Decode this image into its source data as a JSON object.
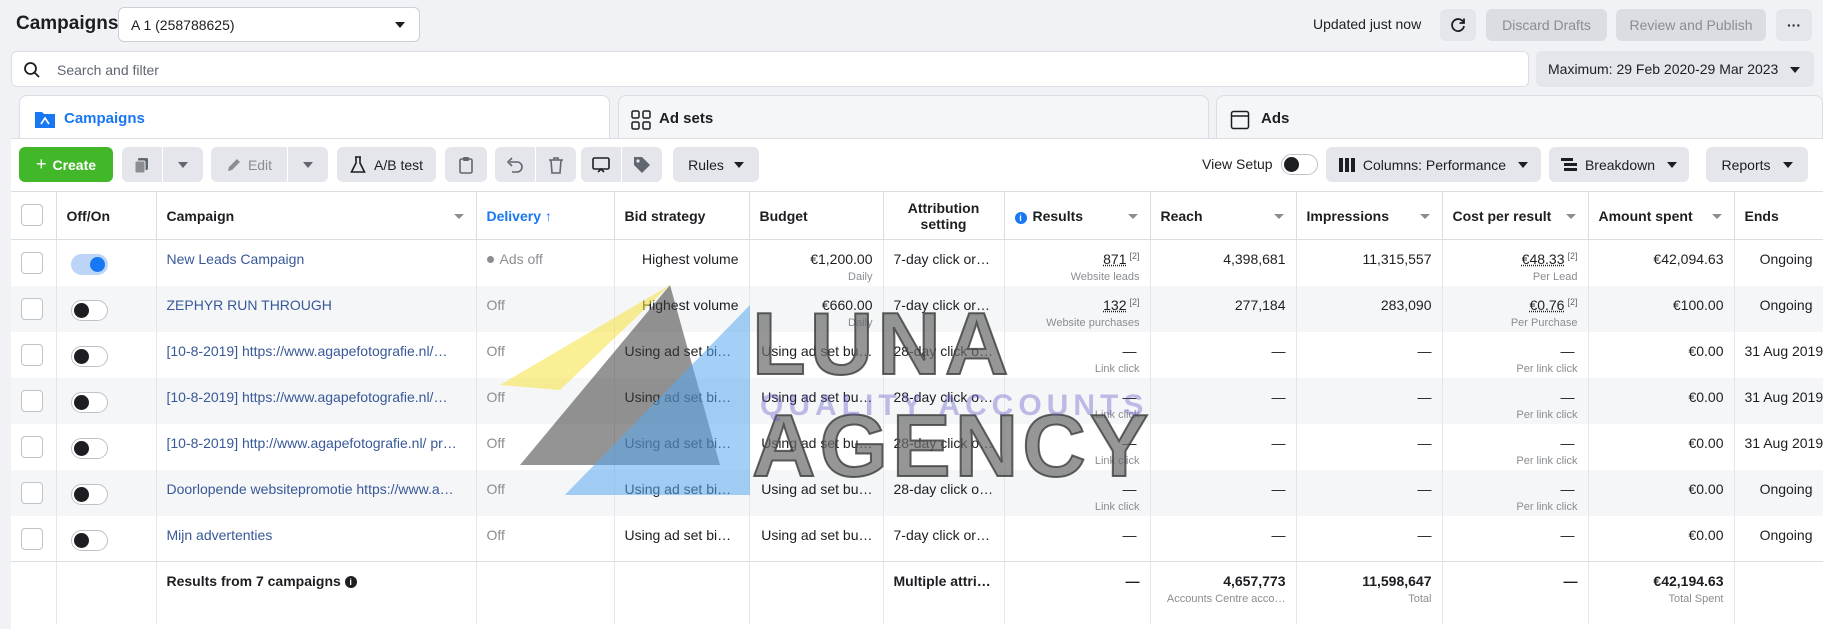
{
  "header": {
    "title": "Campaigns",
    "account_select": "A 1 (258788625)",
    "updated_text": "Updated just now",
    "discard_label": "Discard Drafts",
    "review_label": "Review and Publish",
    "more_label": "···"
  },
  "search": {
    "placeholder": "Search and filter"
  },
  "date_range": "Maximum: 29 Feb 2020-29 Mar 2023",
  "tabs": [
    {
      "label": "Campaigns",
      "active": true
    },
    {
      "label": "Ad sets",
      "active": false
    },
    {
      "label": "Ads",
      "active": false
    }
  ],
  "toolbar": {
    "create_label": "Create",
    "edit_label": "Edit",
    "ab_test_label": "A/B test",
    "rules_label": "Rules",
    "view_setup_label": "View Setup",
    "columns_label": "Columns: Performance",
    "breakdown_label": "Breakdown",
    "reports_label": "Reports"
  },
  "table": {
    "columns": [
      "Off/On",
      "Campaign",
      "Delivery ↑",
      "Bid strategy",
      "Budget",
      "Attribution setting",
      "Results",
      "Reach",
      "Impressions",
      "Cost per result",
      "Amount spent",
      "Ends"
    ],
    "rows": [
      {
        "on": true,
        "campaign": "New Leads Campaign",
        "delivery": "Ads off",
        "bid": "Highest volume",
        "budget": "€1,200.00",
        "budget_sub": "Daily",
        "attr": "7-day click or …",
        "results": "871",
        "results_sup": "[2]",
        "results_sub": "Website leads",
        "reach": "4,398,681",
        "impressions": "11,315,557",
        "cpr": "€48.33",
        "cpr_sup": "[2]",
        "cpr_sub": "Per Lead",
        "spent": "€42,094.63",
        "ends": "Ongoing"
      },
      {
        "on": false,
        "campaign": "ZEPHYR RUN THROUGH",
        "delivery": "Off",
        "bid": "Highest volume",
        "budget": "€660.00",
        "budget_sub": "Daily",
        "attr": "7-day click or …",
        "results": "132",
        "results_sup": "[2]",
        "results_sub": "Website purchases",
        "reach": "277,184",
        "impressions": "283,090",
        "cpr": "€0.76",
        "cpr_sup": "[2]",
        "cpr_sub": "Per Purchase",
        "spent": "€100.00",
        "ends": "Ongoing"
      },
      {
        "on": false,
        "campaign": "[10-8-2019] https://www.agapefotografie.nl/…",
        "delivery": "Off",
        "bid": "Using ad set bid…",
        "budget": "Using ad set bu…",
        "budget_sub": "",
        "attr": "28-day click o…",
        "results": "—",
        "results_sup": "",
        "results_sub": "Link click",
        "reach": "—",
        "impressions": "—",
        "cpr": "—",
        "cpr_sup": "",
        "cpr_sub": "Per link click",
        "spent": "€0.00",
        "ends": "31 Aug 2019"
      },
      {
        "on": false,
        "campaign": "[10-8-2019] https://www.agapefotografie.nl/…",
        "delivery": "Off",
        "bid": "Using ad set bid…",
        "budget": "Using ad set bu…",
        "budget_sub": "",
        "attr": "28-day click o…",
        "results": "—",
        "results_sup": "",
        "results_sub": "Link click",
        "reach": "—",
        "impressions": "—",
        "cpr": "—",
        "cpr_sup": "",
        "cpr_sub": "Per link click",
        "spent": "€0.00",
        "ends": "31 Aug 2019"
      },
      {
        "on": false,
        "campaign": "[10-8-2019] http://www.agapefotografie.nl/ pr…",
        "delivery": "Off",
        "bid": "Using ad set bid…",
        "budget": "Using ad set bu…",
        "budget_sub": "",
        "attr": "28-day click o…",
        "results": "—",
        "results_sup": "",
        "results_sub": "Link click",
        "reach": "—",
        "impressions": "—",
        "cpr": "—",
        "cpr_sup": "",
        "cpr_sub": "Per link click",
        "spent": "€0.00",
        "ends": "31 Aug 2019"
      },
      {
        "on": false,
        "campaign": "Doorlopende websitepromotie https://www.a…",
        "delivery": "Off",
        "bid": "Using ad set bid…",
        "budget": "Using ad set bu…",
        "budget_sub": "",
        "attr": "28-day click o…",
        "results": "—",
        "results_sup": "",
        "results_sub": "Link click",
        "reach": "—",
        "impressions": "—",
        "cpr": "—",
        "cpr_sup": "",
        "cpr_sub": "Per link click",
        "spent": "€0.00",
        "ends": "Ongoing"
      },
      {
        "on": false,
        "campaign": "Mijn advertenties",
        "delivery": "Off",
        "bid": "Using ad set bid…",
        "budget": "Using ad set bu…",
        "budget_sub": "",
        "attr": "7-day click or …",
        "results": "—",
        "results_sup": "",
        "results_sub": "",
        "reach": "—",
        "impressions": "—",
        "cpr": "—",
        "cpr_sup": "",
        "cpr_sub": "",
        "spent": "€0.00",
        "ends": "Ongoing"
      }
    ],
    "totals": {
      "label": "Results from 7 campaigns",
      "attr": "Multiple attrib…",
      "results": "—",
      "reach": "4,657,773",
      "reach_sub": "Accounts Centre acco…",
      "impressions": "11,598,647",
      "impressions_sub": "Total",
      "cpr": "—",
      "spent": "€42,194.63",
      "spent_sub": "Total Spent"
    }
  },
  "watermark": {
    "title": "LUNA AGENCY",
    "subtitle": "QUALITY ACCOUNTS"
  },
  "colors": {
    "accent": "#1877f2",
    "create": "#42b72a",
    "link": "#385898"
  }
}
